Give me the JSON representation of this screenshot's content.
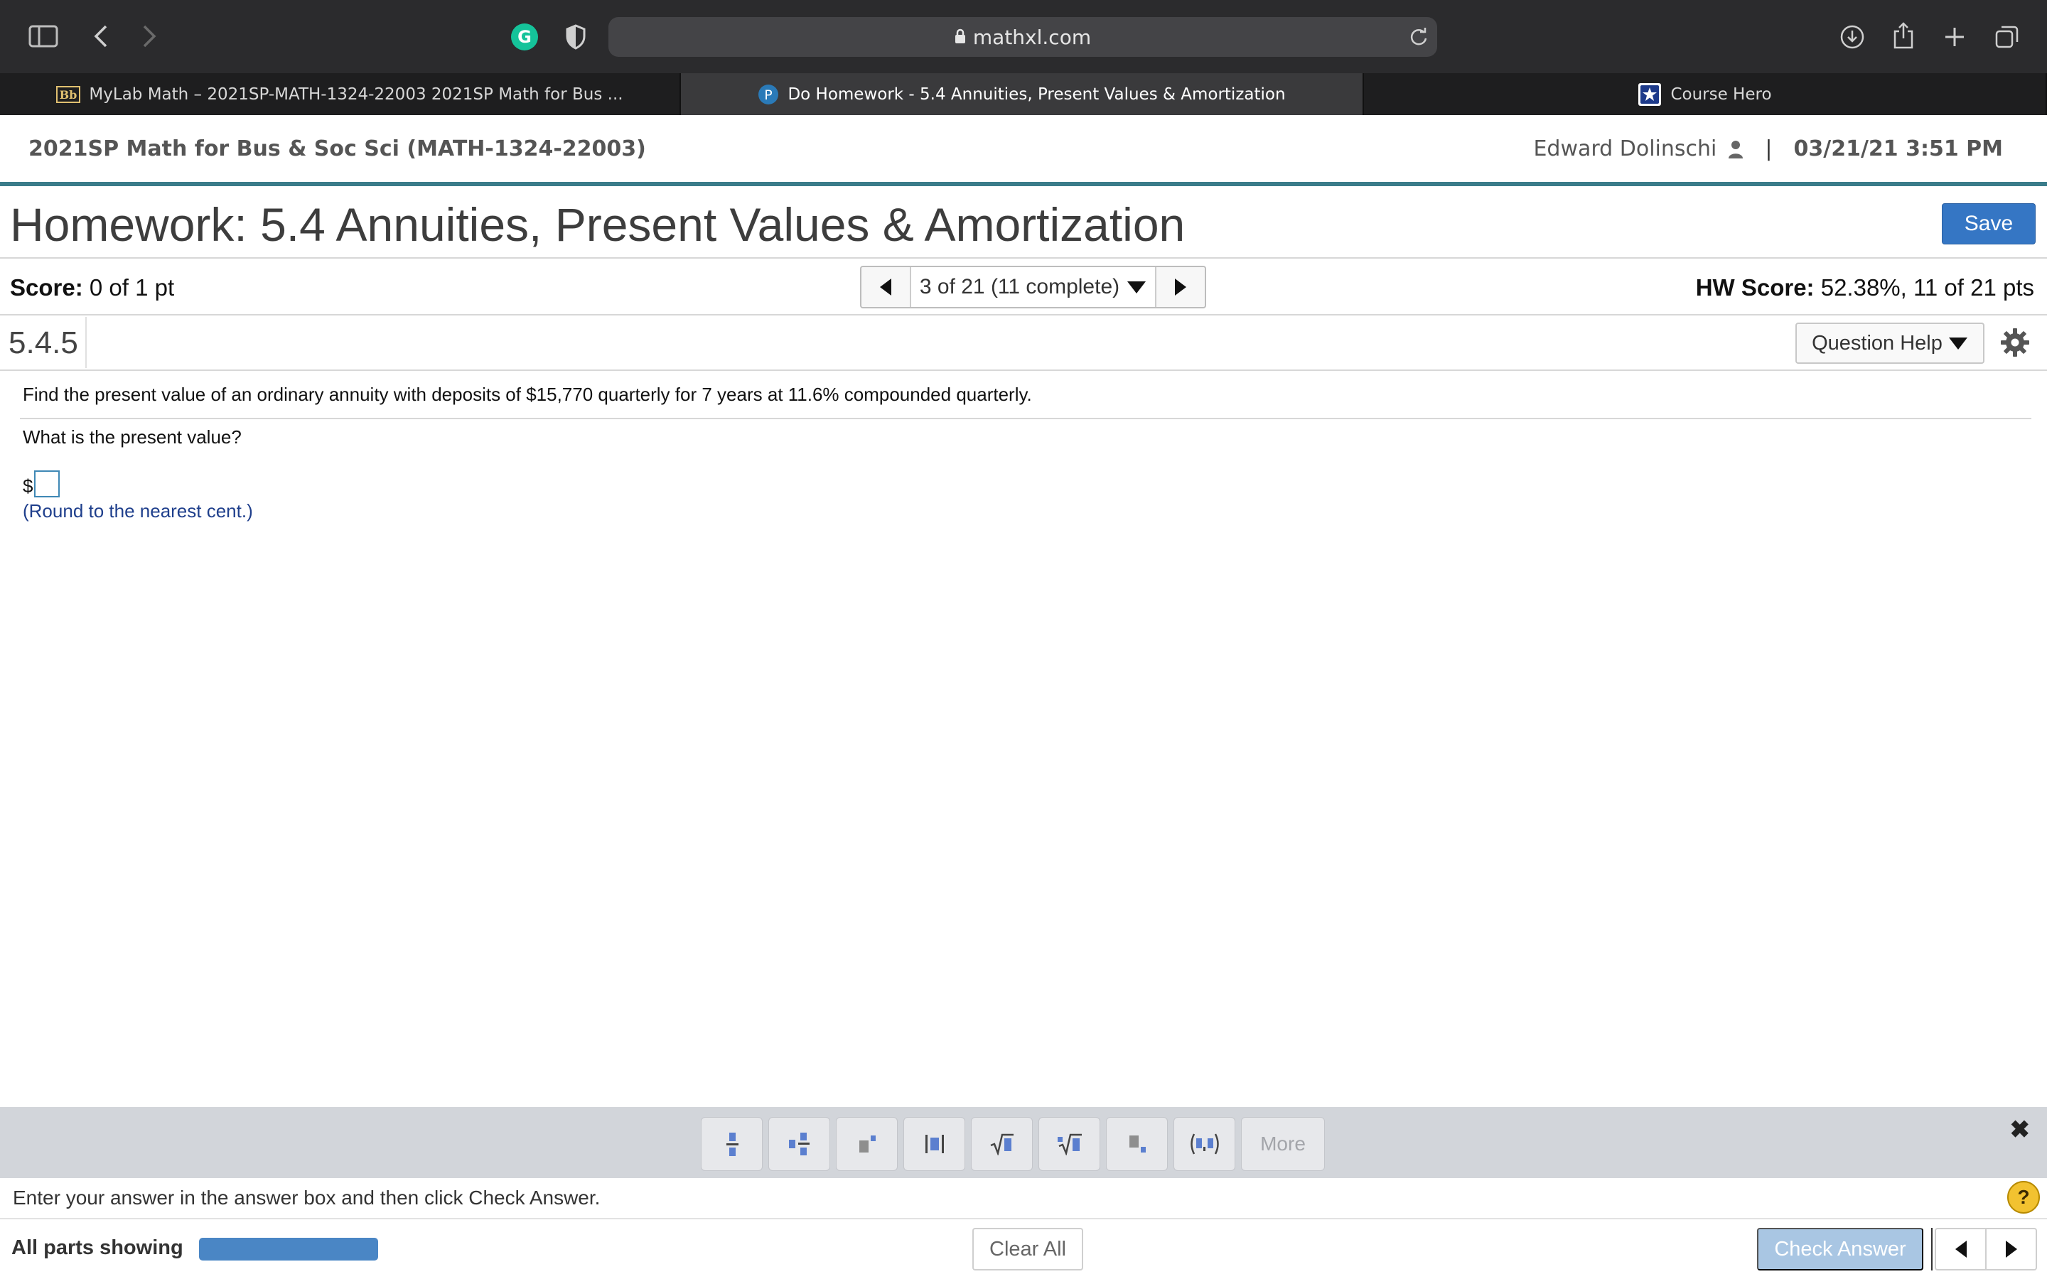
{
  "browser": {
    "url": "mathxl.com",
    "tabs": [
      {
        "label": "MyLab Math – 2021SP-MATH-1324-22003 2021SP Math for Bus ...",
        "icon": "blackboard-icon",
        "favicon_text": "Bb"
      },
      {
        "label": "Do Homework - 5.4 Annuities, Present Values & Amortization",
        "icon": "pearson-icon",
        "favicon_text": "P"
      },
      {
        "label": "Course Hero",
        "icon": "course-hero-icon"
      }
    ]
  },
  "course": {
    "title": "2021SP Math for Bus & Soc Sci (MATH-1324-22003)",
    "user": "Edward Dolinschi",
    "separator": "|",
    "datetime": "03/21/21 3:51 PM"
  },
  "homework": {
    "title": "Homework: 5.4 Annuities, Present Values & Amortization",
    "save_label": "Save",
    "score_label": "Score:",
    "score_value": "0 of 1 pt",
    "nav_label": "3 of 21 (11 complete)",
    "hw_score_label": "HW Score:",
    "hw_score_value": "52.38%, 11 of 21 pts",
    "question_number": "5.4.5",
    "question_help_label": "Question Help"
  },
  "question": {
    "text": "Find the present value of an ordinary annuity with deposits of $15,770 quarterly for 7 years at 11.6% compounded quarterly.",
    "sub": "What is the present value?",
    "currency": "$",
    "answer_value": "",
    "hint": "(Round to the nearest cent.)"
  },
  "palette": {
    "buttons": [
      "fraction-icon",
      "mixed-number-icon",
      "exponent-icon",
      "absolute-value-icon",
      "square-root-icon",
      "nth-root-icon",
      "subscript-icon",
      "ordered-pair-icon"
    ],
    "more_label": "More"
  },
  "footer": {
    "instructions": "Enter your answer in the answer box and then click Check Answer.",
    "parts_label": "All parts showing",
    "progress": 1.0,
    "clear_label": "Clear All",
    "check_label": "Check Answer"
  },
  "colors": {
    "accent": "#3576c4",
    "header_rule": "#3a7c8a",
    "hint": "#1f3f8c",
    "check_disabled": "#a9c6e3",
    "grammarly": "#15c39a"
  }
}
